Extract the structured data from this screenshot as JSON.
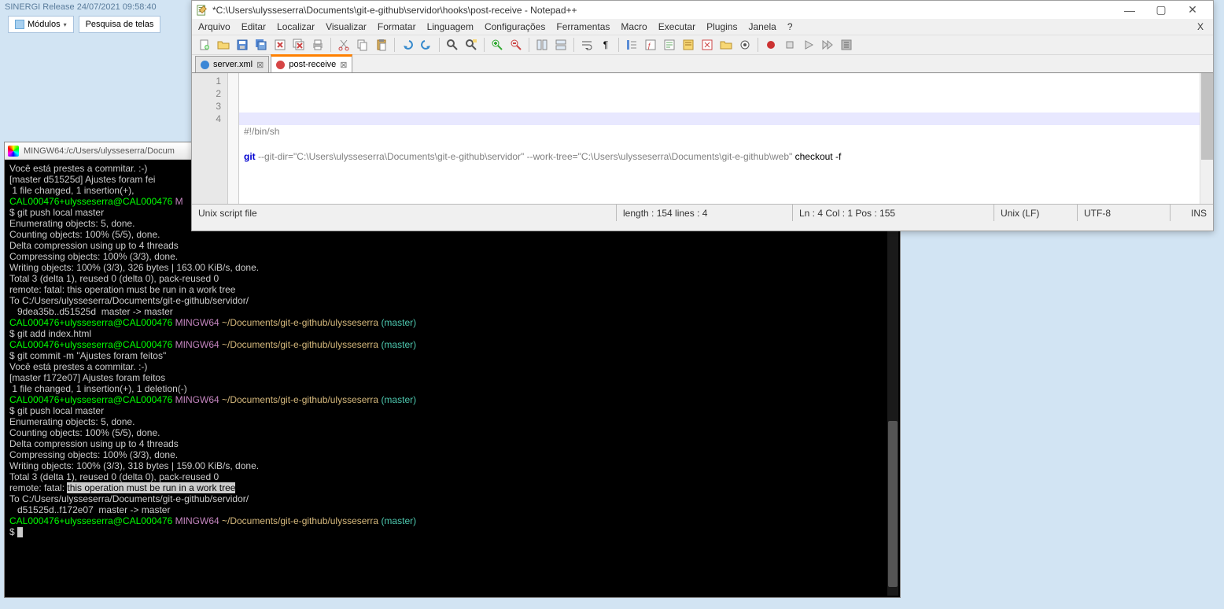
{
  "bg": {
    "title": "SINERGI Release 24/07/2021 09:58:40",
    "btn1": "Módulos",
    "btn2": "Pesquisa de telas"
  },
  "terminal": {
    "title": "MINGW64:/c/Users/ulysseserra/Docum",
    "lines": [
      {
        "segs": [
          {
            "t": "Você está prestes a commitar. :-)"
          }
        ]
      },
      {
        "segs": [
          {
            "t": "[master d51525d] Ajustes foram fei"
          }
        ]
      },
      {
        "segs": [
          {
            "t": " 1 file changed, 1 insertion(+), "
          }
        ]
      },
      {
        "segs": [
          {
            "t": ""
          }
        ]
      },
      {
        "segs": [
          {
            "c": "g",
            "t": "CAL000476+ulysseserra@CAL000476 "
          },
          {
            "c": "p",
            "t": "M"
          }
        ]
      },
      {
        "segs": [
          {
            "t": "$ git push local master"
          }
        ]
      },
      {
        "segs": [
          {
            "t": "Enumerating objects: 5, done."
          }
        ]
      },
      {
        "segs": [
          {
            "t": "Counting objects: 100% (5/5), done."
          }
        ]
      },
      {
        "segs": [
          {
            "t": "Delta compression using up to 4 threads"
          }
        ]
      },
      {
        "segs": [
          {
            "t": "Compressing objects: 100% (3/3), done."
          }
        ]
      },
      {
        "segs": [
          {
            "t": "Writing objects: 100% (3/3), 326 bytes | 163.00 KiB/s, done."
          }
        ]
      },
      {
        "segs": [
          {
            "t": "Total 3 (delta 1), reused 0 (delta 0), pack-reused 0"
          }
        ]
      },
      {
        "segs": [
          {
            "t": "remote: fatal: this operation must be run in a work tree"
          }
        ]
      },
      {
        "segs": [
          {
            "t": "To C:/Users/ulysseserra/Documents/git-e-github/servidor/"
          }
        ]
      },
      {
        "segs": [
          {
            "t": "   9dea35b..d51525d  master -> master"
          }
        ]
      },
      {
        "segs": [
          {
            "t": ""
          }
        ]
      },
      {
        "segs": [
          {
            "c": "g",
            "t": "CAL000476+ulysseserra@CAL000476 "
          },
          {
            "c": "p",
            "t": "MINGW64 "
          },
          {
            "c": "y",
            "t": "~/Documents/git-e-github/ulysseserra "
          },
          {
            "c": "c",
            "t": "(master)"
          }
        ]
      },
      {
        "segs": [
          {
            "t": "$ git add index.html"
          }
        ]
      },
      {
        "segs": [
          {
            "t": ""
          }
        ]
      },
      {
        "segs": [
          {
            "c": "g",
            "t": "CAL000476+ulysseserra@CAL000476 "
          },
          {
            "c": "p",
            "t": "MINGW64 "
          },
          {
            "c": "y",
            "t": "~/Documents/git-e-github/ulysseserra "
          },
          {
            "c": "c",
            "t": "(master)"
          }
        ]
      },
      {
        "segs": [
          {
            "t": "$ git commit -m \"Ajustes foram feitos\""
          }
        ]
      },
      {
        "segs": [
          {
            "t": "Você está prestes a commitar. :-)"
          }
        ]
      },
      {
        "segs": [
          {
            "t": "[master f172e07] Ajustes foram feitos"
          }
        ]
      },
      {
        "segs": [
          {
            "t": " 1 file changed, 1 insertion(+), 1 deletion(-)"
          }
        ]
      },
      {
        "segs": [
          {
            "t": ""
          }
        ]
      },
      {
        "segs": [
          {
            "c": "g",
            "t": "CAL000476+ulysseserra@CAL000476 "
          },
          {
            "c": "p",
            "t": "MINGW64 "
          },
          {
            "c": "y",
            "t": "~/Documents/git-e-github/ulysseserra "
          },
          {
            "c": "c",
            "t": "(master)"
          }
        ]
      },
      {
        "segs": [
          {
            "t": "$ git push local master"
          }
        ]
      },
      {
        "segs": [
          {
            "t": "Enumerating objects: 5, done."
          }
        ]
      },
      {
        "segs": [
          {
            "t": "Counting objects: 100% (5/5), done."
          }
        ]
      },
      {
        "segs": [
          {
            "t": "Delta compression using up to 4 threads"
          }
        ]
      },
      {
        "segs": [
          {
            "t": "Compressing objects: 100% (3/3), done."
          }
        ]
      },
      {
        "segs": [
          {
            "t": "Writing objects: 100% (3/3), 318 bytes | 159.00 KiB/s, done."
          }
        ]
      },
      {
        "segs": [
          {
            "t": "Total 3 (delta 1), reused 0 (delta 0), pack-reused 0"
          }
        ]
      },
      {
        "segs": [
          {
            "t": "remote: fatal: "
          },
          {
            "c": "hl",
            "t": "this operation must be run in a work tree"
          }
        ]
      },
      {
        "segs": [
          {
            "t": "To C:/Users/ulysseserra/Documents/git-e-github/servidor/"
          }
        ]
      },
      {
        "segs": [
          {
            "t": "   d51525d..f172e07  master -> master"
          }
        ]
      },
      {
        "segs": [
          {
            "t": ""
          }
        ]
      },
      {
        "segs": [
          {
            "c": "g",
            "t": "CAL000476+ulysseserra@CAL000476 "
          },
          {
            "c": "p",
            "t": "MINGW64 "
          },
          {
            "c": "y",
            "t": "~/Documents/git-e-github/ulysseserra "
          },
          {
            "c": "c",
            "t": "(master)"
          }
        ]
      },
      {
        "segs": [
          {
            "t": "$ "
          },
          {
            "cursor": true
          }
        ]
      }
    ]
  },
  "npp": {
    "title": "*C:\\Users\\ulysseserra\\Documents\\git-e-github\\servidor\\hooks\\post-receive - Notepad++",
    "menus": [
      "Arquivo",
      "Editar",
      "Localizar",
      "Visualizar",
      "Formatar",
      "Linguagem",
      "Configurações",
      "Ferramentas",
      "Macro",
      "Executar",
      "Plugins",
      "Janela",
      "?"
    ],
    "menu_x": "X",
    "tabs": [
      {
        "label": "server.xml",
        "active": false,
        "dot": "blue"
      },
      {
        "label": "post-receive",
        "active": true,
        "dot": "red"
      }
    ],
    "gutter": [
      "1",
      "2",
      "3",
      "4"
    ],
    "code": {
      "l1": "#!/bin/sh",
      "l3_git": "git",
      "l3_rest": " --git-dir=\"C:\\Users\\ulysseserra\\Documents\\git-e-github\\servidor\" --work-tree=\"C:\\Users\\ulysseserra\\Documents\\git-e-github\\web\"",
      "l3_chk": " checkout -f"
    },
    "status": {
      "type": "Unix script file",
      "len": "length : 154    lines : 4",
      "pos": "Ln : 4    Col : 1    Pos : 155",
      "eol": "Unix (LF)",
      "enc": "UTF-8",
      "ins": "INS"
    }
  }
}
